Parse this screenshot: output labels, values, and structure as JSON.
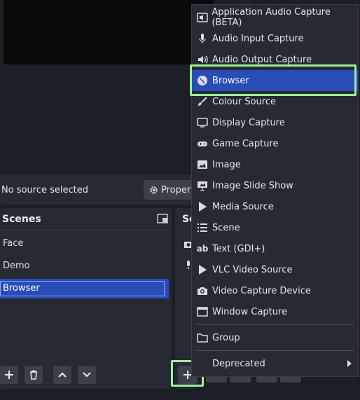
{
  "status": {
    "source_label": "No source selected",
    "properties_label": "Proper"
  },
  "scenes": {
    "title": "Scenes",
    "items": [
      {
        "label": "Face",
        "selected": false
      },
      {
        "label": "Demo",
        "selected": false
      },
      {
        "label": "Browser",
        "selected": true
      }
    ]
  },
  "sources": {
    "title_fragment": "So"
  },
  "add_menu": {
    "items": [
      {
        "label": "Application Audio Capture (BETA)",
        "icon": "speaker-icon"
      },
      {
        "label": "Audio Input Capture",
        "icon": "microphone-icon"
      },
      {
        "label": "Audio Output Capture",
        "icon": "speaker-icon"
      },
      {
        "label": "Browser",
        "icon": "globe-icon",
        "highlighted": true
      },
      {
        "label": "Colour Source",
        "icon": "brush-icon"
      },
      {
        "label": "Display Capture",
        "icon": "monitor-icon"
      },
      {
        "label": "Game Capture",
        "icon": "gamepad-icon"
      },
      {
        "label": "Image",
        "icon": "image-icon"
      },
      {
        "label": "Image Slide Show",
        "icon": "slideshow-icon"
      },
      {
        "label": "Media Source",
        "icon": "play-icon"
      },
      {
        "label": "Scene",
        "icon": "list-icon"
      },
      {
        "label": "Text (GDI+)",
        "icon": "text-icon"
      },
      {
        "label": "VLC Video Source",
        "icon": "play-icon"
      },
      {
        "label": "Video Capture Device",
        "icon": "camera-icon"
      },
      {
        "label": "Window Capture",
        "icon": "window-icon"
      },
      {
        "label": "Group",
        "icon": "folder-icon"
      },
      {
        "label": "Deprecated",
        "icon": "",
        "submenu": true
      }
    ]
  },
  "colors": {
    "accent": "#284cb8",
    "highlight_frame": "#9ef09c",
    "panel": "#272a33",
    "background": "#1d1f26"
  }
}
